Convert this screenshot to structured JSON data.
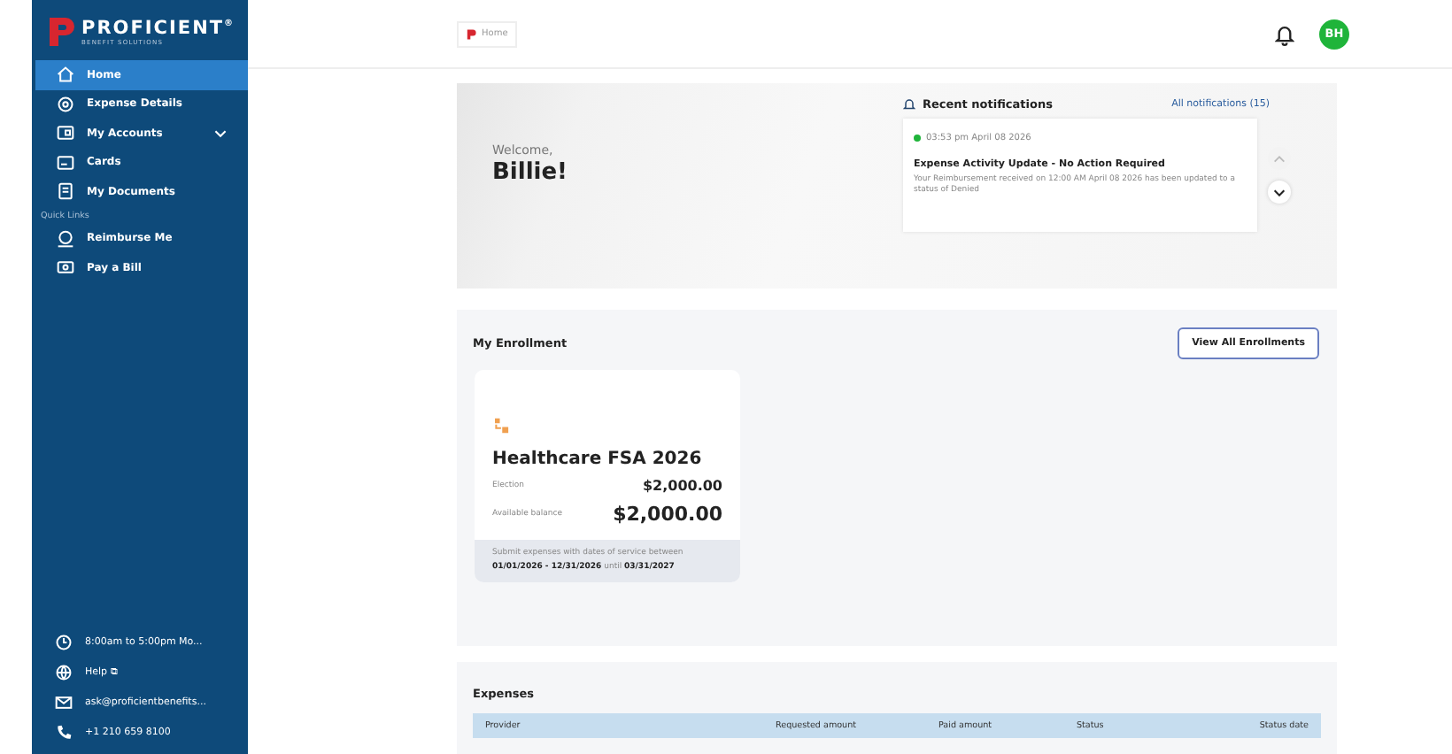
{
  "brand": {
    "name": "PROFICIENT",
    "mark": "®",
    "tagline": "BENEFIT SOLUTIONS"
  },
  "nav": [
    {
      "label": "Home",
      "selected": true,
      "expandable": false
    },
    {
      "label": "Expense Details",
      "selected": false,
      "expandable": false
    },
    {
      "label": "My Accounts",
      "selected": false,
      "expandable": true
    },
    {
      "label": "Cards",
      "selected": false,
      "expandable": false
    },
    {
      "label": "My Documents",
      "selected": false,
      "expandable": false
    }
  ],
  "quick_links": {
    "title": "Quick Links",
    "items": [
      {
        "label": "Reimburse Me"
      },
      {
        "label": "Pay a Bill"
      }
    ]
  },
  "contact": [
    "8:00am to 5:00pm Mo...",
    "Help ⧉",
    "ask@proficientbenefits...",
    "+1 210 659 8100"
  ],
  "breadcrumb": "Home",
  "user": {
    "initials": "BH"
  },
  "welcome": {
    "greeting": "Welcome,",
    "name": "Billie!"
  },
  "notifications": {
    "title": "Recent notifications",
    "link": "All notifications (15)",
    "items": [
      {
        "time": "03:53 pm April 08 2026",
        "unread": true,
        "title": "Expense Activity Update - No Action Required",
        "body": "Your Reimbursement received on 12:00 AM April 08 2026 has been updated to a status of Denied"
      }
    ]
  },
  "enrollment": {
    "title": "My Enrollment",
    "button": "View All Enrollments",
    "cards": [
      {
        "name": "Healthcare FSA 2026",
        "election_label": "Election",
        "election": "$2,000.00",
        "balance_label": "Available balance",
        "balance": "$2,000.00",
        "note": "Submit expenses with dates of service between",
        "period": "01/01/2026 - 12/31/2026",
        "until_word": "until",
        "deadline": "03/31/2027"
      }
    ]
  },
  "expenses": {
    "title": "Expenses",
    "columns": [
      "Provider",
      "Requested amount",
      "Paid amount",
      "Status",
      "Status date"
    ]
  }
}
